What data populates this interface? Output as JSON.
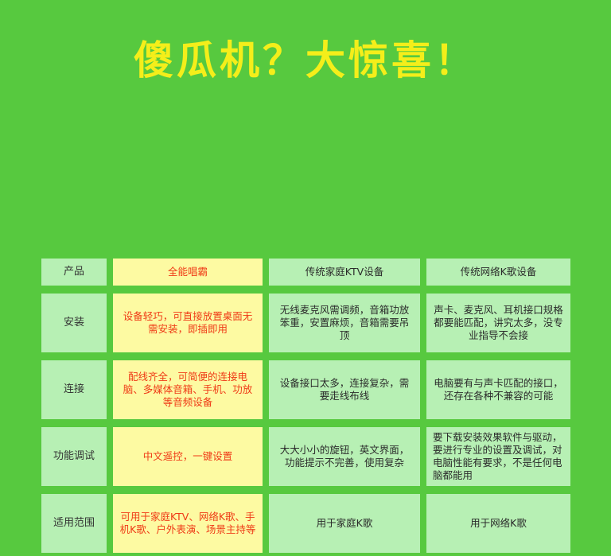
{
  "title": "傻瓜机？大惊喜！",
  "colors": {
    "background": "#57c93f",
    "title": "#f4ee1a",
    "cell": "#b7f0b4",
    "highlight_cell": "#fdfaa2",
    "highlight_text": "#ef3a16"
  },
  "table": {
    "headers": [
      "产品",
      "全能唱霸",
      "传统家庭KTV设备",
      "传统网络K歌设备"
    ],
    "rows": [
      {
        "label": "安装",
        "cells": [
          "设备轻巧，可直接放置桌面无需安装，即插即用",
          "无线麦克风需调频，音箱功放笨重，安置麻烦，音箱需要吊顶",
          "声卡、麦克风、耳机接口规格都要能匹配，讲究太多，没专业指导不会接"
        ]
      },
      {
        "label": "连接",
        "cells": [
          "配线齐全，可简便的连接电脑、多媒体音箱、手机、功放等音频设备",
          "设备接口太多，连接复杂，需要走线布线",
          "电脑要有与声卡匹配的接口，还存在各种不兼容的可能"
        ]
      },
      {
        "label": "功能调试",
        "cells": [
          "中文遥控，一键设置",
          "大大小小的旋钮，英文界面，功能提示不完善，使用复杂",
          "要下载安装效果软件与驱动，要进行专业的设置及调试，对电脑性能有要求，不是任何电脑都能用"
        ]
      },
      {
        "label": "适用范围",
        "cells": [
          "可用于家庭KTV、网络K歌、手机K歌、户外表演、场景主持等",
          "用于家庭K歌",
          "用于网络K歌"
        ]
      }
    ]
  }
}
